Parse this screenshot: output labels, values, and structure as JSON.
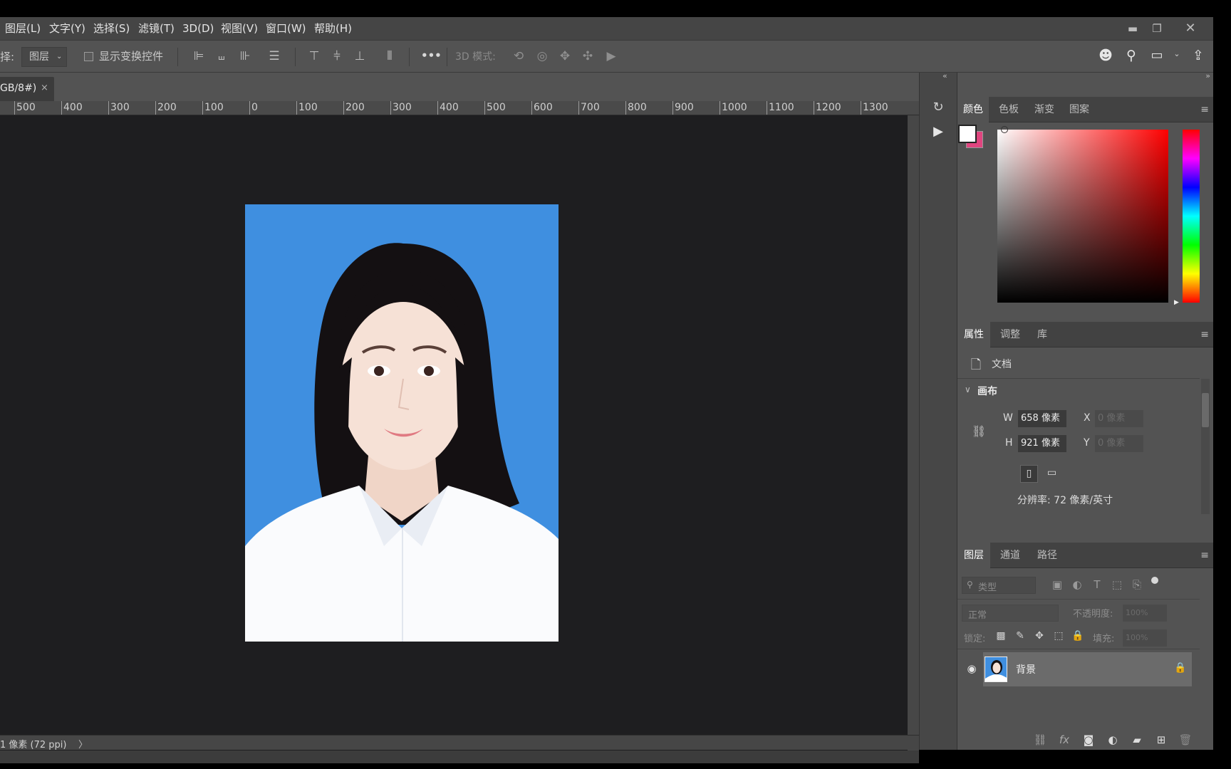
{
  "menubar": {
    "items": [
      "图层(L)",
      "文字(Y)",
      "选择(S)",
      "滤镜(T)",
      "3D(D)",
      "视图(V)",
      "窗口(W)",
      "帮助(H)"
    ]
  },
  "options_bar": {
    "cut_label": "择:",
    "auto_select_value": "图层",
    "show_transform_label": "显示变换控件",
    "more_label": "•••",
    "mode_3d_label": "3D 模式:"
  },
  "document": {
    "tab_title": "GB/8#)",
    "close_glyph": "×"
  },
  "ruler": {
    "ticks": [
      "500",
      "400",
      "300",
      "200",
      "100",
      "0",
      "100",
      "200",
      "300",
      "400",
      "500",
      "600",
      "700",
      "800",
      "900",
      "1000",
      "1100",
      "1200",
      "1300"
    ]
  },
  "status_bar": {
    "text": "1 像素 (72 ppi)",
    "arrow": "〉"
  },
  "color_panel": {
    "tabs": [
      "颜色",
      "色板",
      "渐变",
      "图案"
    ],
    "active_tab": "颜色",
    "foreground_color": "#ffffff",
    "background_color": "#e0457f"
  },
  "properties_panel": {
    "tabs": [
      "属性",
      "调整",
      "库"
    ],
    "active_tab": "属性",
    "doc_label": "文档",
    "canvas_heading": "画布",
    "width_label": "W",
    "width_value": "658 像素",
    "height_label": "H",
    "height_value": "921 像素",
    "x_label": "X",
    "x_placeholder": "0 像素",
    "y_label": "Y",
    "y_placeholder": "0 像素",
    "resolution": "分辨率: 72 像素/英寸"
  },
  "layers_panel": {
    "tabs": [
      "图层",
      "通道",
      "路径"
    ],
    "active_tab": "图层",
    "filter_placeholder": "类型",
    "blend_mode": "正常",
    "opacity_label": "不透明度:",
    "opacity_value": "100%",
    "lock_label": "锁定:",
    "fill_label": "填充:",
    "fill_value": "100%",
    "layers": [
      {
        "name": "背景",
        "visible": true,
        "locked": true
      }
    ]
  },
  "tool_strip": {
    "collapse_left": "«",
    "collapse_right": "»"
  }
}
